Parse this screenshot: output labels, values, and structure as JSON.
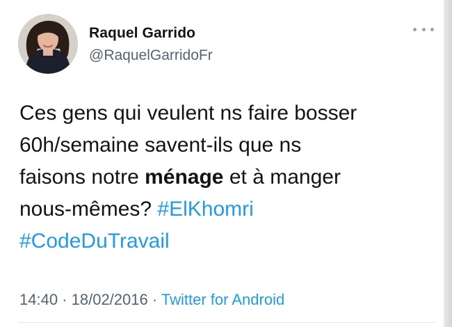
{
  "author": {
    "name": "Raquel Garrido",
    "handle": "@RaquelGarridoFr"
  },
  "tweet": {
    "line1": "Ces gens qui veulent ns faire bosser",
    "line2": "60h/semaine savent-ils que ns",
    "line3_pre": "faisons notre ",
    "line3_bold": "ménage",
    "line3_post": " et à manger",
    "line4_pre": "nous-mêmes? ",
    "hashtag1": "#ElKhomri",
    "hashtag2": "#CodeDuTravail"
  },
  "meta": {
    "time": "14:40",
    "separator": " · ",
    "date": "18/02/2016",
    "source": "Twitter for Android"
  },
  "icons": {
    "avatar": "avatar-photo",
    "more": "more-dots-icon"
  },
  "colors": {
    "link": "#1d9bf0",
    "text": "#0f1419",
    "secondary": "#536471"
  }
}
